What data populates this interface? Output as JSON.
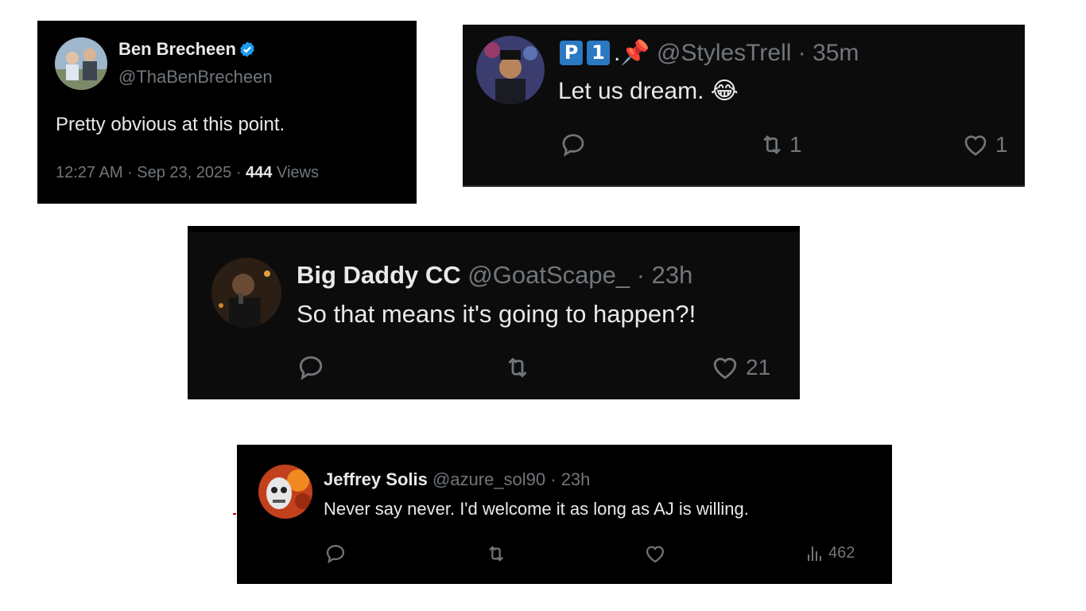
{
  "tweets": [
    {
      "name": "Ben Brecheen",
      "handle": "@ThaBenBrecheen",
      "text": "Pretty obvious at this point.",
      "time": "12:27 AM · Sep 23, 2025 · ",
      "views_count": "444",
      "views_label": " Views",
      "verified": true
    },
    {
      "badge_p": "P",
      "badge_1": "1",
      "name_suffix": ".📌",
      "handle_time": " @StylesTrell · 35m",
      "text": "Let us dream. 😂",
      "retweets": "1",
      "likes": "1"
    },
    {
      "name": "Big Daddy CC",
      "handle_time": " @GoatScape_ · 23h",
      "text": "So that means it's going to happen?!",
      "retweets": "",
      "likes": "21"
    },
    {
      "name": "Jeffrey Solis",
      "handle_time": " @azure_sol90 · 23h",
      "text": "Never say never. I'd welcome it as long as AJ is willing.",
      "views": "462"
    }
  ],
  "colors": {
    "background": "#000000",
    "text": "#e7e9ea",
    "muted": "#71767b",
    "verified": "#1d9bf0",
    "badge": "#2b79c2"
  },
  "icons": [
    "reply-icon",
    "retweet-icon",
    "like-icon",
    "views-icon",
    "verified-icon"
  ]
}
